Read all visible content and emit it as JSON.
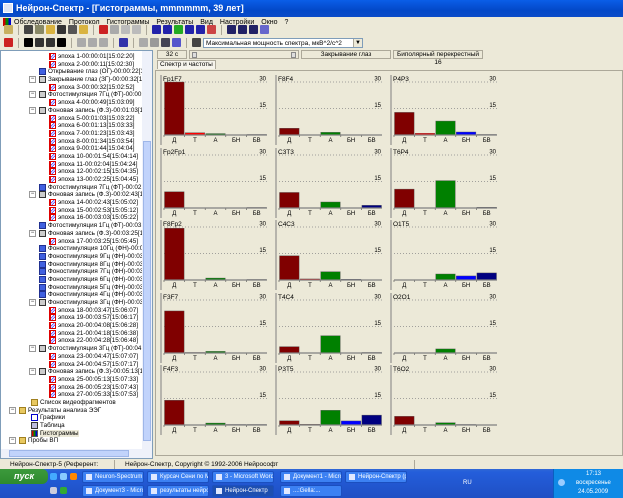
{
  "window": {
    "title": "Нейрон-Спектр - [Гистограммы, mmmmmm, 39 лет]"
  },
  "menu": [
    "Обследование",
    "Протокол",
    "Гистограммы",
    "Результаты",
    "Вид",
    "Настройки",
    "Окно",
    "?"
  ],
  "toolbar": {
    "combo_value": "Максимальная мощность спектра, мкВ^2/с^2"
  },
  "controls": {
    "time": "32 с",
    "event": "Закрывание глаз",
    "montage": "Биполярный перекрестный 16"
  },
  "tab": "Спектр и частоты",
  "tree": [
    {
      "t": "эпоха 1-00:00:01[15:02:20]",
      "l": 3,
      "k": "epoch"
    },
    {
      "t": "эпоха 2-00:00:11[15:02:30]",
      "l": 3,
      "k": "epoch"
    },
    {
      "t": "Открывание глаз (ОГ)-00:00:22[15:02:42",
      "l": 2,
      "k": "leaf"
    },
    {
      "t": "Закрывание глаз (ЗГ)-00:00:32[15:02:52",
      "l": 2,
      "k": "group"
    },
    {
      "t": "эпоха 3-00:00:32[15:02:52]",
      "l": 3,
      "k": "epoch"
    },
    {
      "t": "Фотостимуляция 7Гц (ФТ)-00:00:49[15:0",
      "l": 2,
      "k": "group"
    },
    {
      "t": "эпоха 4-00:00:49[15:03:09]",
      "l": 3,
      "k": "epoch"
    },
    {
      "t": "Фоновая запись (Ф.З)-00:01:03[15:03:2",
      "l": 2,
      "k": "group"
    },
    {
      "t": "эпоха 5-00:01:03[15:03:22]",
      "l": 3,
      "k": "epoch"
    },
    {
      "t": "эпоха 6-00:01:13[15:03:33]",
      "l": 3,
      "k": "epoch"
    },
    {
      "t": "эпоха 7-00:01:23[15:03:43]",
      "l": 3,
      "k": "epoch"
    },
    {
      "t": "эпоха 8-00:01:34[15:03:54]",
      "l": 3,
      "k": "epoch"
    },
    {
      "t": "эпоха 9-00:01:44[15:04:04]",
      "l": 3,
      "k": "epoch"
    },
    {
      "t": "эпоха 10-00:01:54[15:04:14]",
      "l": 3,
      "k": "epoch"
    },
    {
      "t": "эпоха 11-00:02:04[15:04:24]",
      "l": 3,
      "k": "epoch"
    },
    {
      "t": "эпоха 12-00:02:15[15:04:35]",
      "l": 3,
      "k": "epoch"
    },
    {
      "t": "эпоха 13-00:02:25[15:04:45]",
      "l": 3,
      "k": "epoch"
    },
    {
      "t": "Фотостимуляция 7Гц (ФТ)-00:02:38[15:0",
      "l": 2,
      "k": "leaf"
    },
    {
      "t": "Фоновая запись (Ф.З)-00:02:43[15:05:02",
      "l": 2,
      "k": "group"
    },
    {
      "t": "эпоха 14-00:02:43[15:05:02]",
      "l": 3,
      "k": "epoch"
    },
    {
      "t": "эпоха 15-00:02:53[15:05:12]",
      "l": 3,
      "k": "epoch"
    },
    {
      "t": "эпоха 16-00:03:03[15:05:22]",
      "l": 3,
      "k": "epoch"
    },
    {
      "t": "Фотостимуляция 1Гц (ФТ)-00:03:16[15:0",
      "l": 2,
      "k": "leaf"
    },
    {
      "t": "Фоновая запись (Ф.З)-00:03:25[15:05:45",
      "l": 2,
      "k": "group"
    },
    {
      "t": "эпоха 17-00:03:25[15:05:45]",
      "l": 3,
      "k": "epoch"
    },
    {
      "t": "Фоностимуляция 10Гц (ФН)-00:03:41[15:",
      "l": 2,
      "k": "leaf"
    },
    {
      "t": "Фоностимуляция 9Гц (ФН)-00:03:44[15:",
      "l": 2,
      "k": "leaf"
    },
    {
      "t": "Фоностимуляция 8Гц (ФН)-00:03:45[15:",
      "l": 2,
      "k": "leaf"
    },
    {
      "t": "Фоностимуляция 7Гц (ФН)-00:03:45[15:",
      "l": 2,
      "k": "leaf"
    },
    {
      "t": "Фоностимуляция 6Гц (ФН)-00:03:45[15:",
      "l": 2,
      "k": "leaf"
    },
    {
      "t": "Фоностимуляция 5Гц (ФН)-00:03:46[15:",
      "l": 2,
      "k": "leaf"
    },
    {
      "t": "Фоностимуляция 4Гц (ФН)-00:03:47[15:",
      "l": 2,
      "k": "leaf"
    },
    {
      "t": "Фоностимуляция 3Гц (ФН)-00:03:47[15:",
      "l": 2,
      "k": "group"
    },
    {
      "t": "эпоха 18-00:03:47[15:06:07]",
      "l": 3,
      "k": "epoch"
    },
    {
      "t": "эпоха 19-00:03:57[15:06:17]",
      "l": 3,
      "k": "epoch"
    },
    {
      "t": "эпоха 20-00:04:08[15:06:28]",
      "l": 3,
      "k": "epoch"
    },
    {
      "t": "эпоха 21-00:04:18[15:06:38]",
      "l": 3,
      "k": "epoch"
    },
    {
      "t": "эпоха 22-00:04:28[15:06:48]",
      "l": 3,
      "k": "epoch"
    },
    {
      "t": "Фотостимуляция 3Гц (ФТ)-00:04:47[15:",
      "l": 2,
      "k": "group"
    },
    {
      "t": "эпоха 23-00:04:47[15:07:07]",
      "l": 3,
      "k": "epoch"
    },
    {
      "t": "эпоха 24-00:04:57[15:07:17]",
      "l": 3,
      "k": "epoch"
    },
    {
      "t": "Фоновая запись (Ф.З)-00:05:13[15:07:3",
      "l": 2,
      "k": "group"
    },
    {
      "t": "эпоха 25-00:05:13[15:07:33]",
      "l": 3,
      "k": "epoch"
    },
    {
      "t": "эпоха 26-00:05:23[15:07:43]",
      "l": 3,
      "k": "epoch"
    },
    {
      "t": "эпоха 27-00:05:33[15:07:53]",
      "l": 3,
      "k": "epoch"
    },
    {
      "t": "Список видеофрагментов",
      "l": 1,
      "k": "folder"
    },
    {
      "t": "Результаты анализа ЭЭГ",
      "l": 0,
      "k": "folder"
    },
    {
      "t": "Графики",
      "l": 1,
      "k": "graph"
    },
    {
      "t": "Таблица",
      "l": 1,
      "k": "table"
    },
    {
      "t": "Гистограммы",
      "l": 1,
      "k": "chart"
    },
    {
      "t": "Пробы ВП",
      "l": 0,
      "k": "folder"
    }
  ],
  "chart_data": {
    "type": "bar",
    "categories": [
      "Д",
      "Т",
      "А",
      "БН",
      "БВ"
    ],
    "colors": [
      "#800000",
      "#ff0000",
      "#008000",
      "#0000ff",
      "#000080"
    ],
    "ylim": [
      0,
      30
    ],
    "yticks": [
      "30",
      "15"
    ],
    "panels": [
      {
        "name": "Fp1F7",
        "values": [
          30,
          1.3,
          0.8,
          0,
          0.3
        ]
      },
      {
        "name": "F8F4",
        "values": [
          3.8,
          0,
          1.5,
          0,
          0
        ]
      },
      {
        "name": "P4P3",
        "values": [
          12.8,
          1,
          7.9,
          1.7,
          0.3
        ]
      },
      {
        "name": "Fp2Fp1",
        "values": [
          9.2,
          0,
          0,
          0,
          0.3
        ]
      },
      {
        "name": "C3T3",
        "values": [
          8.8,
          0,
          3.4,
          0,
          1.5
        ]
      },
      {
        "name": "T6P4",
        "values": [
          10.7,
          0,
          15.5,
          0,
          0.4
        ]
      },
      {
        "name": "F8Fp2",
        "values": [
          29.3,
          0,
          1.1,
          0,
          0.3
        ]
      },
      {
        "name": "C4C3",
        "values": [
          13.7,
          0.6,
          4.7,
          0.4,
          0
        ]
      },
      {
        "name": "O1T5",
        "values": [
          0,
          0,
          3.4,
          2.3,
          4
        ]
      },
      {
        "name": "F3F7",
        "values": [
          23.8,
          0.3,
          0.9,
          0,
          0
        ]
      },
      {
        "name": "T4C4",
        "values": [
          3.6,
          0,
          9.8,
          0,
          0.3
        ]
      },
      {
        "name": "O2O1",
        "values": [
          0,
          0,
          2.3,
          0,
          0
        ]
      },
      {
        "name": "F4F3",
        "values": [
          14,
          0,
          1.1,
          0.3,
          0.3
        ]
      },
      {
        "name": "P3T5",
        "values": [
          2.4,
          0.4,
          8.3,
          2.3,
          5.6
        ]
      },
      {
        "name": "T6O2",
        "values": [
          4.9,
          0,
          1.3,
          0.3,
          0
        ]
      }
    ]
  },
  "status": {
    "left": "Нейрон-Спектр-5 (Референт: REF)",
    "right": "Нейрон-Спектр, Copyright © 1992-2006 Нейрософт"
  },
  "taskbar": {
    "start": "пуск",
    "buttons": [
      "Neuron-Spectrum",
      "Курсач Сени по Моб...",
      "3 - Microsoft Word",
      "Документ1 - Microso...",
      "Нейрон-Спектр (рук...",
      "Документ3 - Microso...",
      "результаты нейрос...",
      "Нейрон-Спектр",
      "...:Gella:..."
    ],
    "lang": "RU",
    "time": "17:13",
    "day": "воскресенье",
    "date": "24.05.2009"
  }
}
